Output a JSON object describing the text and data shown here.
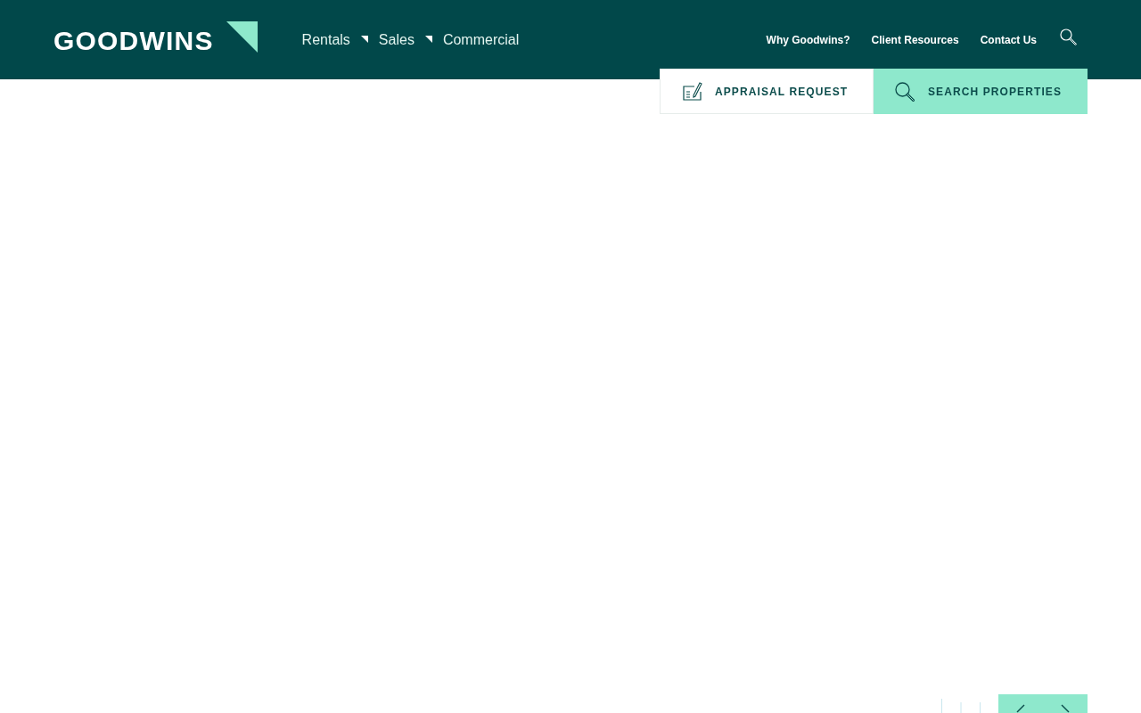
{
  "header": {
    "logo": "GOODWINS",
    "main_nav": [
      {
        "label": "Rentals"
      },
      {
        "label": "Sales"
      },
      {
        "label": "Commercial"
      }
    ],
    "utility_nav": [
      {
        "label": "Why Goodwins?"
      },
      {
        "label": "Client Resources"
      },
      {
        "label": "Contact Us"
      }
    ]
  },
  "quick_actions": [
    {
      "label": "APPRAISAL REQUEST",
      "kind": "appraisal"
    },
    {
      "label": "SEARCH PROPERTIES",
      "kind": "search"
    }
  ]
}
